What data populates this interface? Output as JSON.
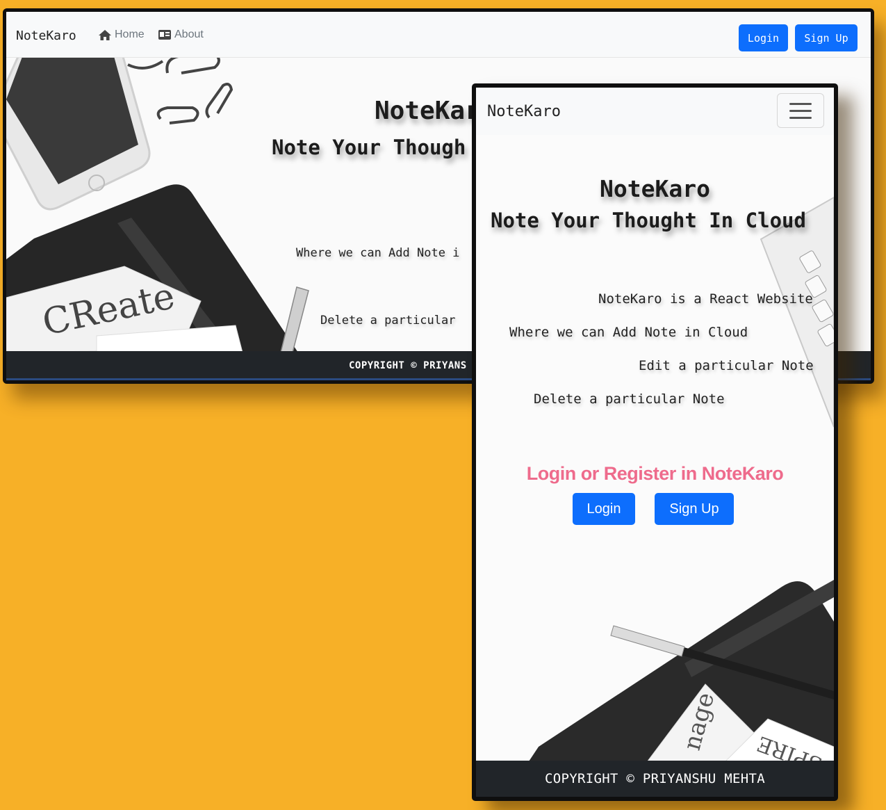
{
  "desktop": {
    "nav": {
      "brand": "NoteKaro",
      "home_label": "Home",
      "about_label": "About",
      "login_label": "Login",
      "signup_label": "Sign Up"
    },
    "hero": {
      "title": "NoteKar",
      "subtitle": "Note Your Though",
      "line_add": "Where we can Add Note i",
      "line_delete": "Delete a particular",
      "art_text": "CReate"
    },
    "footer": {
      "text": "COPYRIGHT © PRIYANS"
    }
  },
  "mobile": {
    "nav": {
      "brand": "NoteKaro"
    },
    "hero": {
      "title": "NoteKaro",
      "subtitle": "Note Your Thought In Cloud",
      "lines": [
        "NoteKaro is a React Website",
        "Where we can Add Note in Cloud",
        "Edit a particular Note",
        "Delete a particular Note"
      ],
      "cta": "Login or Register in NoteKaro",
      "login_label": "Login",
      "signup_label": "Sign Up",
      "art_text_1": "nage",
      "art_text_2": "SPIRE"
    },
    "footer": {
      "text": "COPYRIGHT © PRIYANSHU MEHTA"
    }
  },
  "colors": {
    "background": "#f7b027",
    "primary": "#0d6efd",
    "cta": "#ee6b8c",
    "footer": "#212529"
  }
}
